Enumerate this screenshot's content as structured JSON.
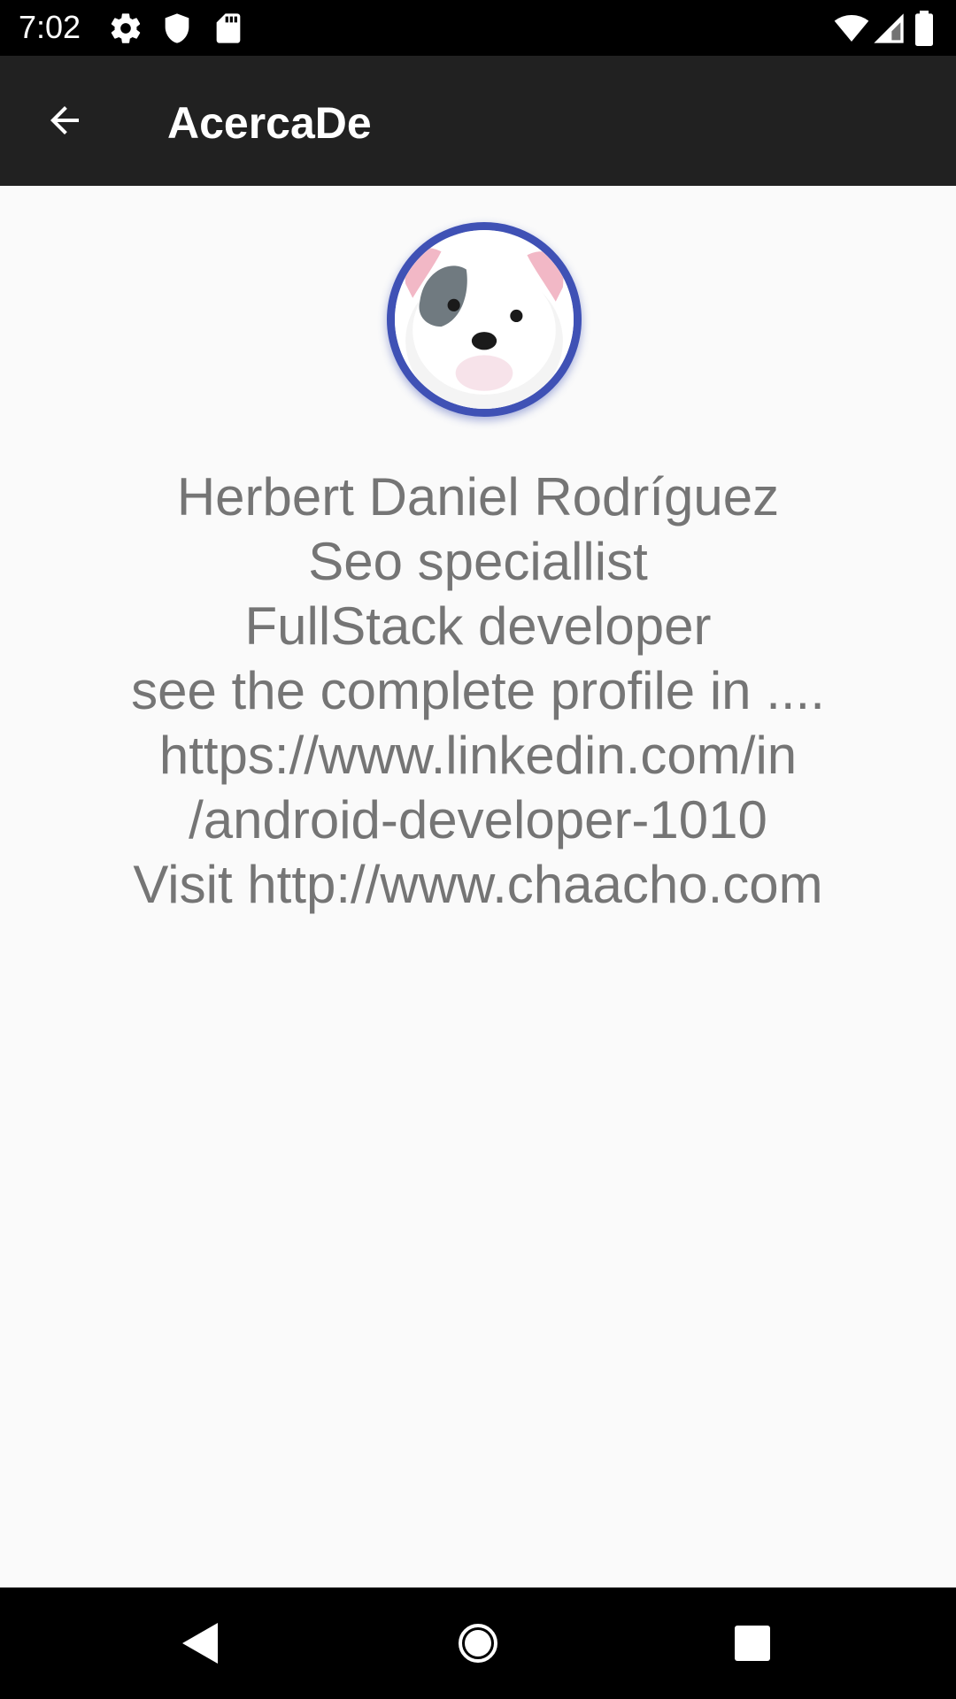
{
  "status_bar": {
    "time": "7:02",
    "left_icons": [
      "settings-icon",
      "shield-icon",
      "sd-card-icon"
    ],
    "right_icons": [
      "wifi-icon",
      "cell-signal-icon",
      "battery-icon"
    ]
  },
  "app_bar": {
    "title": "AcercaDe",
    "back_icon": "arrow-back-icon"
  },
  "profile": {
    "avatar_icon": "dog-avatar-icon",
    "avatar_border_color": "#3f51b5",
    "lines": [
      "Herbert Daniel Rodríguez",
      "Seo speciallist",
      "FullStack developer",
      "see the complete profile in ....",
      "https://www.linkedin.com/in",
      "/android-developer-1010",
      "Visit http://www.chaacho.com"
    ]
  },
  "nav_bar": {
    "buttons": [
      "back-triangle-icon",
      "home-circle-icon",
      "recents-square-icon"
    ]
  },
  "colors": {
    "status_bar_bg": "#000000",
    "app_bar_bg": "#212121",
    "content_bg": "#fafafa",
    "text_gray": "#757575",
    "accent": "#3f51b5"
  }
}
